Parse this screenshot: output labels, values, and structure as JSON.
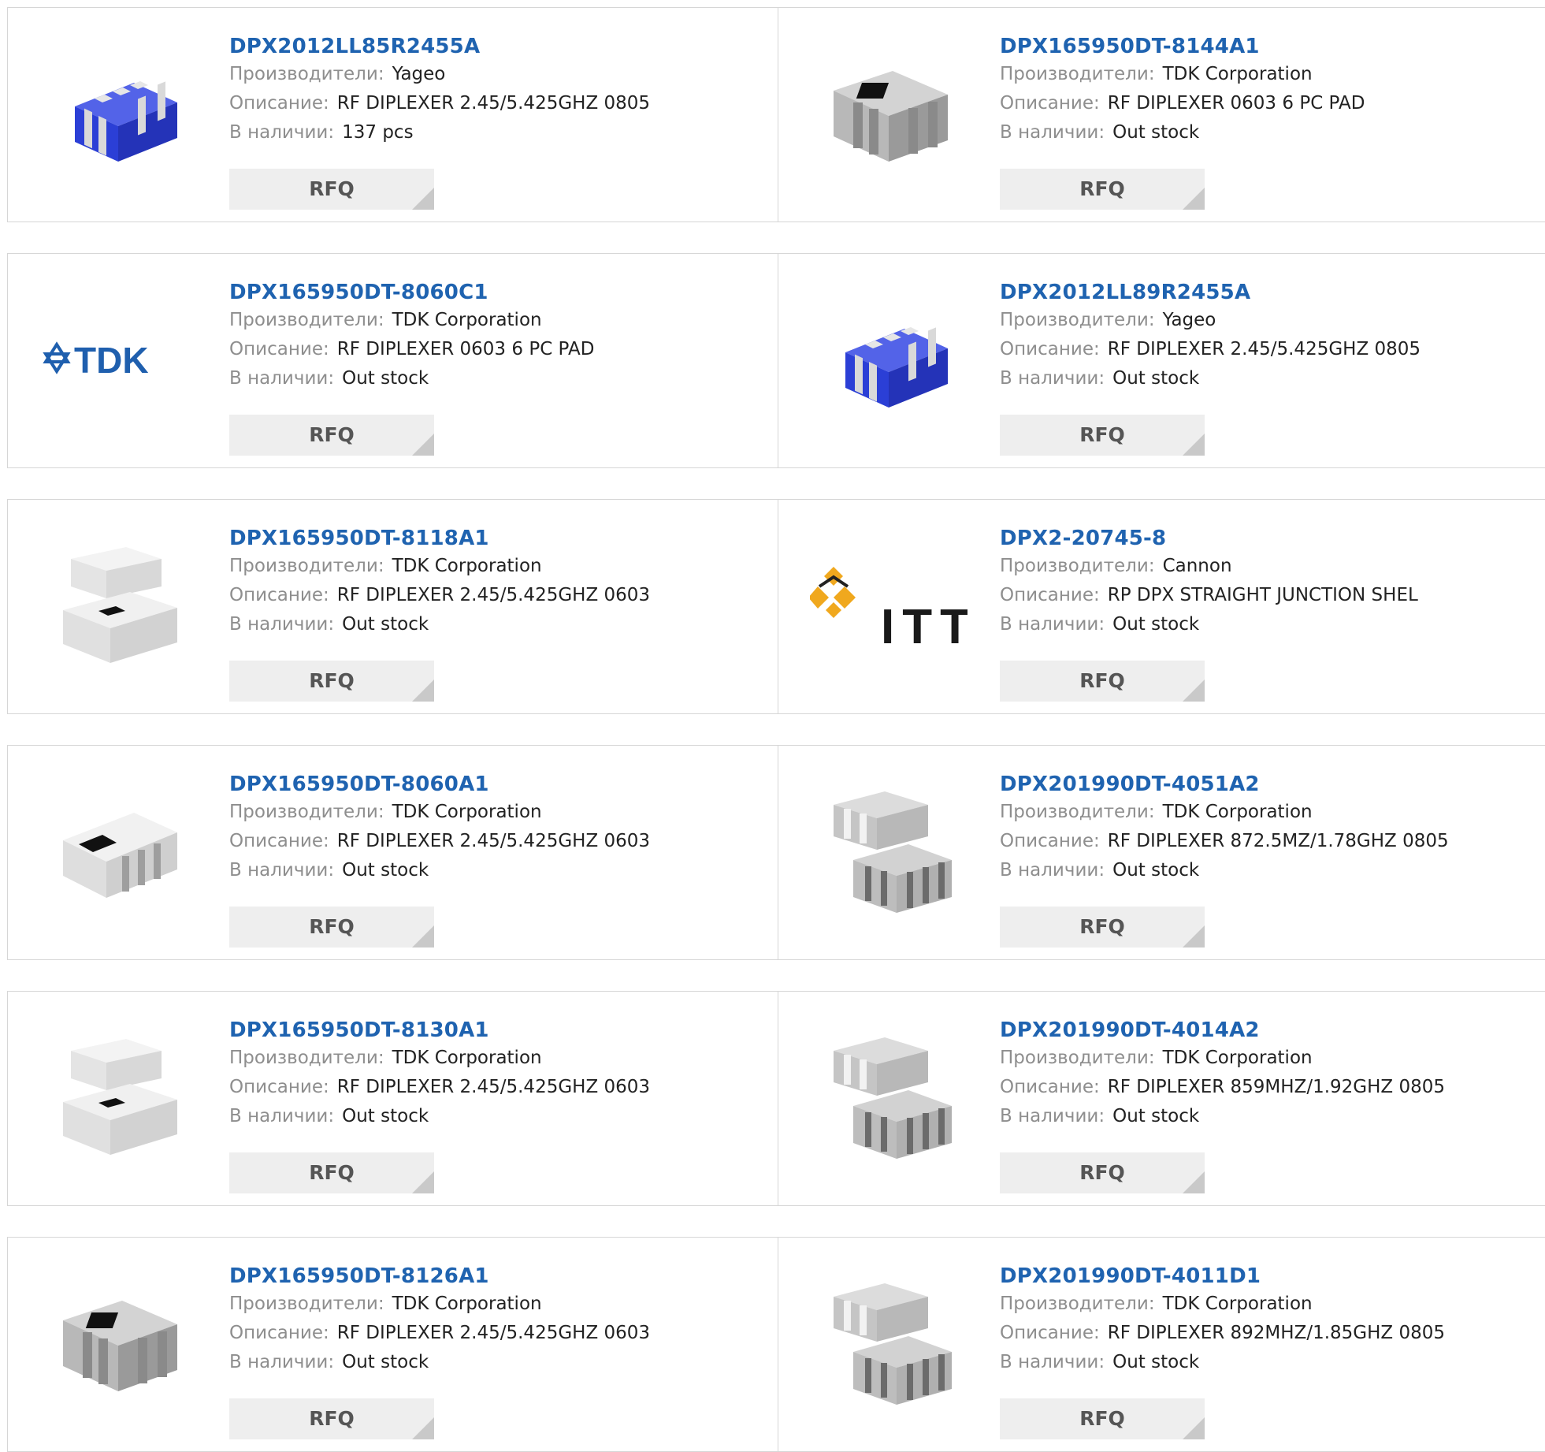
{
  "labels": {
    "manufacturer": "Производители:",
    "description": "Описание:",
    "stock": "В наличии:",
    "rfq": "RFQ"
  },
  "products": [
    {
      "part": "DPX2012LL85R2455A",
      "manufacturer": "Yageo",
      "description": "RF DIPLEXER 2.45/5.425GHZ 0805",
      "stock": "137 pcs",
      "image": "blue-chip-icon"
    },
    {
      "part": "DPX165950DT-8144A1",
      "manufacturer": "TDK Corporation",
      "description": "RF DIPLEXER 0603 6 PC PAD",
      "stock": "Out stock",
      "image": "gray-chip-icon"
    },
    {
      "part": "DPX165950DT-8060C1",
      "manufacturer": "TDK Corporation",
      "description": "RF DIPLEXER 0603 6 PC PAD",
      "stock": "Out stock",
      "image": "tdk-logo",
      "logo_text": "TDK"
    },
    {
      "part": "DPX2012LL89R2455A",
      "manufacturer": "Yageo",
      "description": "RF DIPLEXER 2.45/5.425GHZ 0805",
      "stock": "Out stock",
      "image": "blue-chip-icon"
    },
    {
      "part": "DPX165950DT-8118A1",
      "manufacturer": "TDK Corporation",
      "description": "RF DIPLEXER 2.45/5.425GHZ 0603",
      "stock": "Out stock",
      "image": "white-chip-pair-icon"
    },
    {
      "part": "DPX2-20745-8",
      "manufacturer": "Cannon",
      "description": "RP DPX STRAIGHT JUNCTION SHEL",
      "stock": "Out stock",
      "image": "itt-logo",
      "logo_text": "ITT"
    },
    {
      "part": "DPX165950DT-8060A1",
      "manufacturer": "TDK Corporation",
      "description": "RF DIPLEXER 2.45/5.425GHZ 0603",
      "stock": "Out stock",
      "image": "white-chip-icon"
    },
    {
      "part": "DPX201990DT-4051A2",
      "manufacturer": "TDK Corporation",
      "description": "RF DIPLEXER 872.5MZ/1.78GHZ 0805",
      "stock": "Out stock",
      "image": "gray-chip-pair-icon"
    },
    {
      "part": "DPX165950DT-8130A1",
      "manufacturer": "TDK Corporation",
      "description": "RF DIPLEXER 2.45/5.425GHZ 0603",
      "stock": "Out stock",
      "image": "white-chip-pair-icon"
    },
    {
      "part": "DPX201990DT-4014A2",
      "manufacturer": "TDK Corporation",
      "description": "RF DIPLEXER 859MHZ/1.92GHZ 0805",
      "stock": "Out stock",
      "image": "gray-chip-pair-icon"
    },
    {
      "part": "DPX165950DT-8126A1",
      "manufacturer": "TDK Corporation",
      "description": "RF DIPLEXER 2.45/5.425GHZ 0603",
      "stock": "Out stock",
      "image": "gray-chip-icon"
    },
    {
      "part": "DPX201990DT-4011D1",
      "manufacturer": "TDK Corporation",
      "description": "RF DIPLEXER 892MHZ/1.85GHZ 0805",
      "stock": "Out stock",
      "image": "gray-chip-pair-icon"
    }
  ],
  "colors": {
    "link": "#1f63b0",
    "label": "#8e8e8e",
    "border": "#d6d6d6",
    "button": "#eeeeee",
    "chip_blue": "#2b3fd6",
    "itt_gold": "#f0a81e"
  }
}
